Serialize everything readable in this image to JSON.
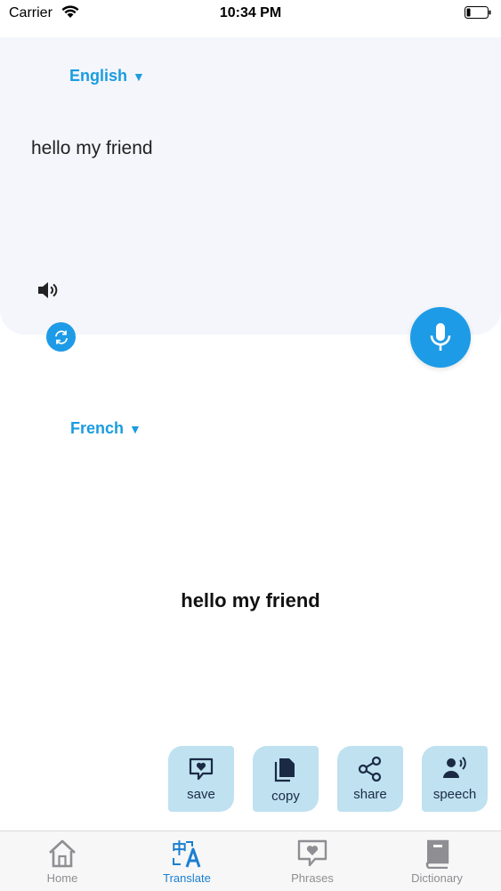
{
  "status_bar": {
    "carrier": "Carrier",
    "time": "10:34 PM"
  },
  "source": {
    "language": "English",
    "text": "hello my friend"
  },
  "target": {
    "language": "French",
    "text": "hello my friend"
  },
  "actions": {
    "save": "save",
    "copy": "copy",
    "share": "share",
    "speech": "speech"
  },
  "tabs": {
    "home": "Home",
    "translate": "Translate",
    "phrases": "Phrases",
    "dictionary": "Dictionary",
    "active": "Translate"
  },
  "colors": {
    "accent": "#1e9be6",
    "action_bg": "#bfe1f0",
    "panel_bg": "#f4f6fb"
  }
}
